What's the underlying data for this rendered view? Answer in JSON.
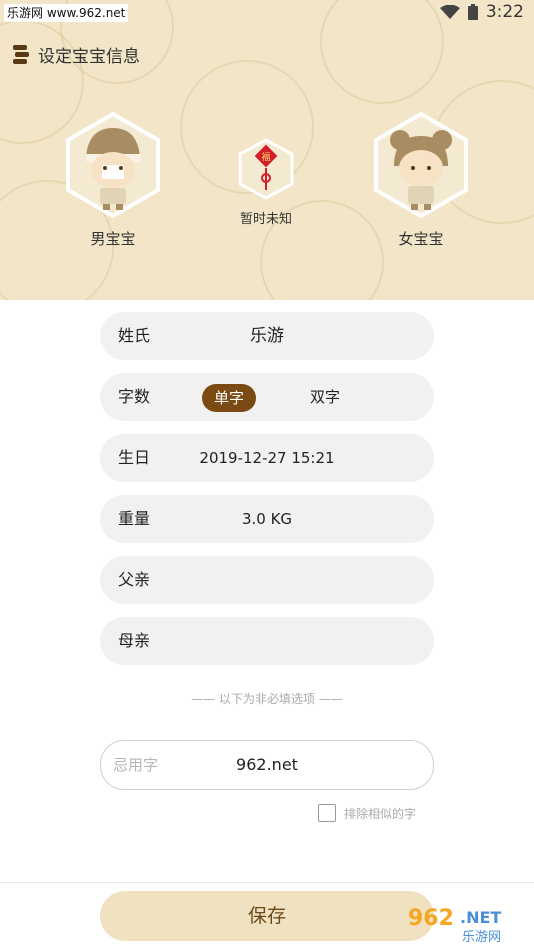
{
  "status_bar": {
    "left_text": "乐游网 www.962.net",
    "time": "3:22",
    "icons": [
      "wifi-icon",
      "battery-icon"
    ]
  },
  "header": {
    "title": "设定宝宝信息",
    "icon": "book-stack-icon",
    "background_color": "#f3e6c8"
  },
  "gender_options": [
    {
      "label": "男宝宝",
      "icon": "boy-avatar-icon"
    },
    {
      "label": "暂时未知",
      "icon": "fortune-knot-icon"
    },
    {
      "label": "女宝宝",
      "icon": "girl-avatar-icon"
    }
  ],
  "form": {
    "surname": {
      "label": "姓氏",
      "value": "乐游"
    },
    "char_count": {
      "label": "字数",
      "options": [
        "单字",
        "双字"
      ],
      "selected": "单字"
    },
    "birthday": {
      "label": "生日",
      "value": "2019-12-27 15:21"
    },
    "weight": {
      "label": "重量",
      "value": "3.0 KG"
    },
    "father": {
      "label": "父亲",
      "value": ""
    },
    "mother": {
      "label": "母亲",
      "value": ""
    }
  },
  "optional_divider": "—— 以下为非必填选项 ——",
  "avoid_chars": {
    "placeholder": "忌用字",
    "value": "962.net"
  },
  "exclude_similar": {
    "label": "排除相似的字",
    "checked": false
  },
  "save_button": "保存",
  "watermark": {
    "text": "962.NET",
    "subtext": "乐游网"
  },
  "colors": {
    "accent": "#7a4a12",
    "save_bg": "#f0e2c1",
    "field_bg": "#f1f1f1"
  }
}
